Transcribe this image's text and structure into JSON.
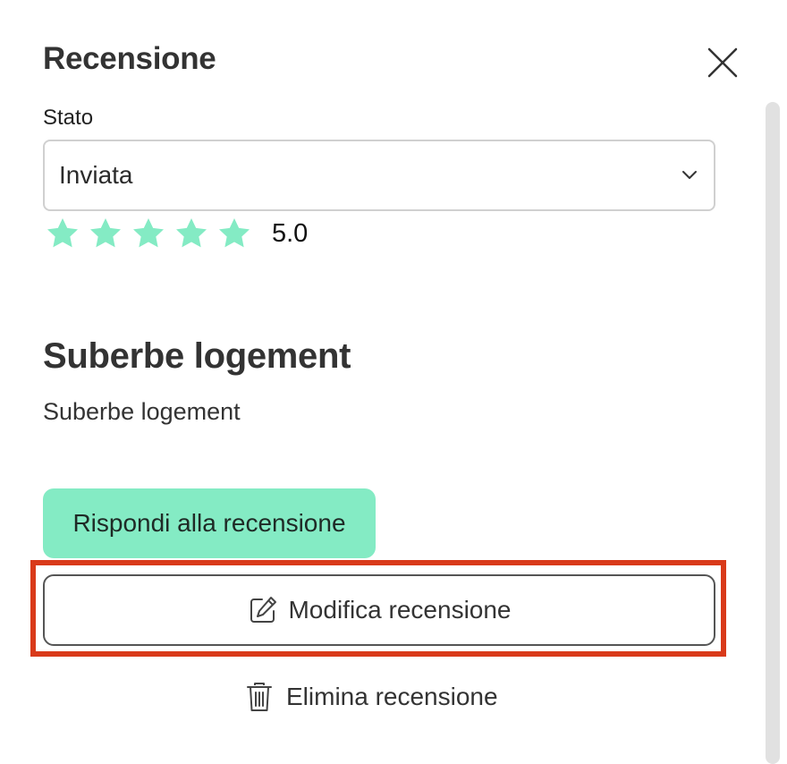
{
  "panel": {
    "title": "Recensione",
    "close_icon": "close-icon"
  },
  "status": {
    "label": "Stato",
    "value": "Inviata",
    "chevron_icon": "chevron-down-icon"
  },
  "rating": {
    "stars": 5,
    "max_stars": 5,
    "value_text": "5.0",
    "star_color": "#84ebc4"
  },
  "review": {
    "title": "Suberbe logement",
    "body": "Suberbe logement"
  },
  "actions": {
    "reply_label": "Rispondi alla recensione",
    "reply_color": "#84ebc4",
    "edit_label": "Modifica recensione",
    "edit_icon": "edit-icon",
    "delete_label": "Elimina recensione",
    "delete_icon": "trash-icon",
    "highlight_color": "#d93a1a"
  }
}
